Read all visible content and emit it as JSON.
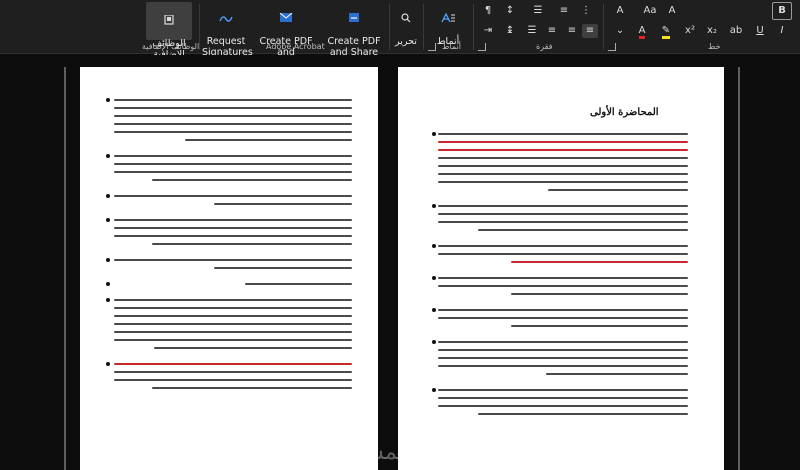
{
  "ribbon": {
    "addins": {
      "button_label": "الوظائف\nالإضافية",
      "group_label": "الوظائف الإضافية"
    },
    "adobe": {
      "request_signatures": "Request\nSignatures",
      "create_pdf_outlook": "Create PDF and\nShare via Outlook",
      "create_pdf_link": "Create PDF\nand Share link",
      "group_label": "Adobe Acrobat"
    },
    "editing": {
      "label": "تحرير"
    },
    "styles": {
      "button_label": "أنماط",
      "group_label": "أنماط"
    },
    "paragraph": {
      "group_label": "فقرة"
    },
    "font": {
      "group_label": "خط",
      "bold": "B"
    }
  },
  "document": {
    "right_page_title": "المحاضرة الأولى",
    "watermark": "خمسات"
  },
  "colors": {
    "ribbon_bg": "#1f1f1f",
    "doc_bg": "#0d0d0d",
    "page_bg": "#ffffff",
    "highlight_red": "#c9272c",
    "font_color_red": "#e0242a",
    "highlight_yellow": "#f5e11d"
  },
  "icons": [
    "addins-icon",
    "signature-icon",
    "pdf-outlook-icon",
    "pdf-link-icon",
    "find-icon",
    "styles-icon",
    "pilcrow-icon",
    "sort-icon",
    "align-right-icon",
    "align-center-icon",
    "align-left-icon",
    "justify-icon",
    "bold-icon",
    "font-color-icon",
    "highlight-icon"
  ]
}
